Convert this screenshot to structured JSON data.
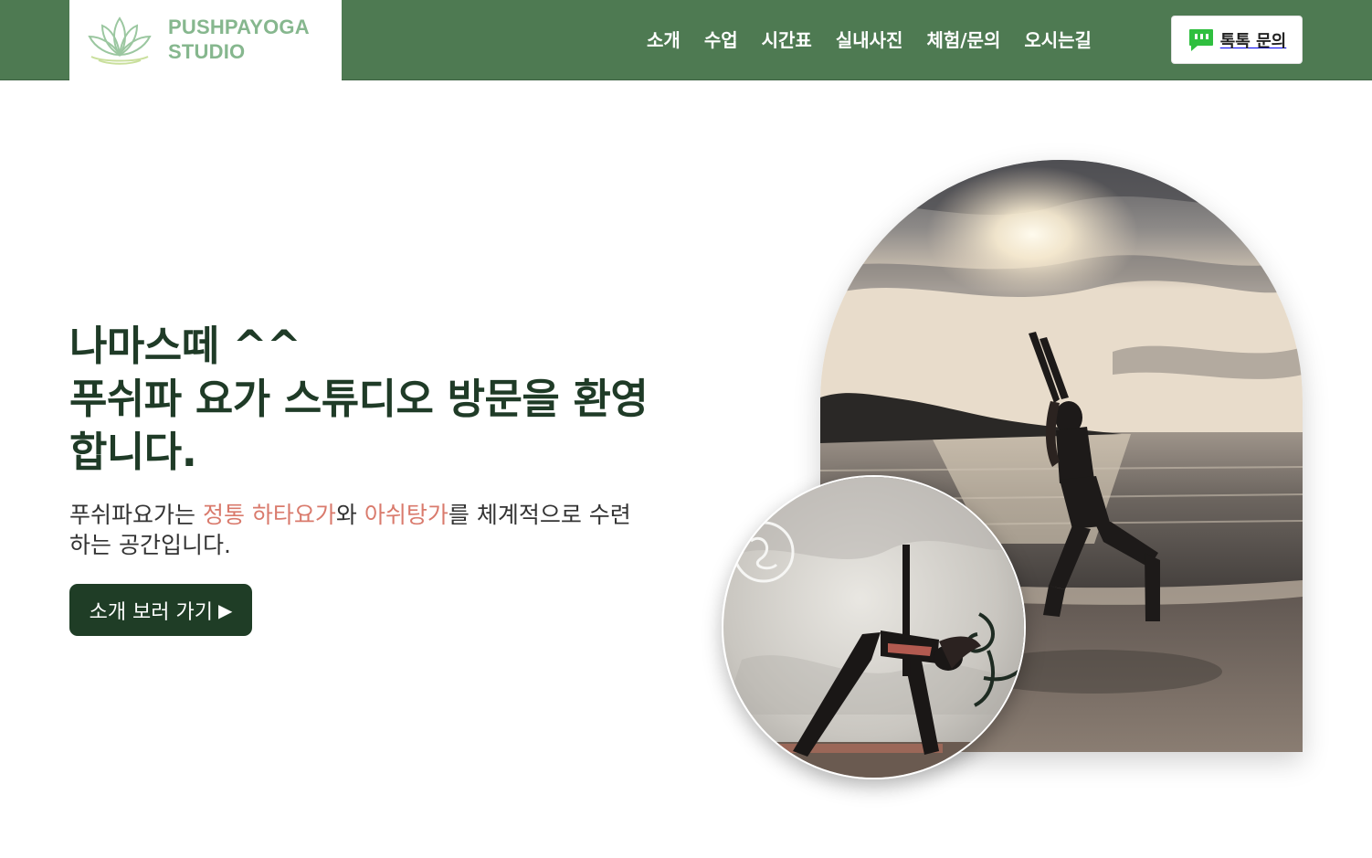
{
  "brand": {
    "line1": "PUSHPAYOGA",
    "line2": "STUDIO",
    "logo_icon": "lotus-icon",
    "colors": {
      "header_bg": "#4e7a52",
      "logo_text": "#86b78e"
    }
  },
  "nav": {
    "items": [
      "소개",
      "수업",
      "시간표",
      "실내사진",
      "체험/문의",
      "오시는길"
    ]
  },
  "talk_button": {
    "label": "톡톡 문의",
    "icon": "chat-bubble-icon",
    "icon_color": "#2fbf3f"
  },
  "hero": {
    "title_line1": "나마스떼 ^^",
    "title_line2": "푸쉬파 요가 스튜디오 방문을 환영",
    "title_line3": "합니다.",
    "desc_part1": "푸쉬파요가는 ",
    "desc_hl1": "정통 하타요가",
    "desc_part2": "와 ",
    "desc_hl2": "아쉬탕가",
    "desc_part3": "를 체계적으로 수련",
    "desc_part4": "하는 공간입니다.",
    "cta_label": "소개 보러 가기",
    "cta_icon": "play-triangle-icon",
    "colors": {
      "title": "#1f3b27",
      "highlight": "#d97a6c",
      "cta_bg": "#1f3d26"
    }
  },
  "images": {
    "beach_photo": "woman in crescent lunge pose on beach at sunset",
    "studio_photo": "woman in triangle pose against textured wall"
  }
}
